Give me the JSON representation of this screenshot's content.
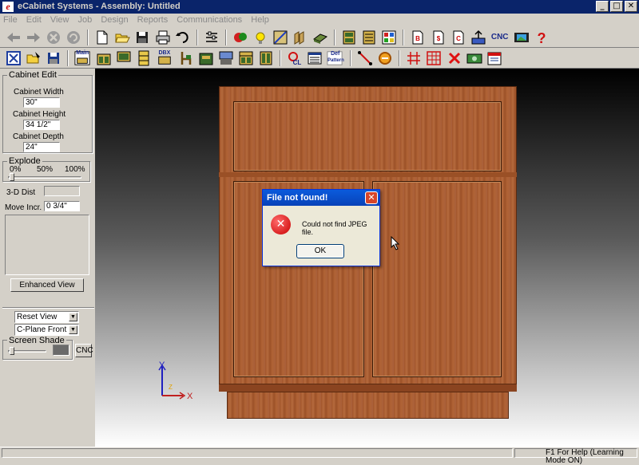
{
  "window": {
    "title": "eCabinet Systems - Assembly: Untitled",
    "icon_glyph": "e",
    "minimize_glyph": "_",
    "maximize_glyph": "□",
    "close_glyph": "✕"
  },
  "menu": [
    "File",
    "Edit",
    "View",
    "Job",
    "Design",
    "Reports",
    "Communications",
    "Help"
  ],
  "toolbar1_icons": [
    "back-icon",
    "forward-icon",
    "stop-icon",
    "refresh-icon",
    "new-icon",
    "open-icon",
    "save-icon",
    "print-icon",
    "undo-icon",
    "properties-icon",
    "parts-icon",
    "light-icon",
    "render-icon",
    "panels-icon",
    "material-icon",
    "cabinet-list-icon",
    "cabinet-grid-icon",
    "cabinet-color-icon",
    "bid-report-icon",
    "cost-report-icon",
    "cutlist-report-icon",
    "export-icon",
    "cnc-icon",
    "video-icon",
    "help-icon"
  ],
  "toolbar1_cnc_label": "CNC",
  "toolbar2_icons": [
    "cabinet-edit-icon",
    "open-assembly-icon",
    "save-assembly-icon",
    "main-icon",
    "base-cabinet-icon",
    "wall-cabinet-icon",
    "tall-cabinet-icon",
    "dbx-icon",
    "chair-icon",
    "drawer-icon",
    "corner-icon",
    "hutch-icon",
    "pantry-icon",
    "cutlist-icon",
    "def-icon",
    "pattern-icon",
    "line-draw-icon",
    "curve-icon",
    "grid-icon",
    "table-icon",
    "delete-icon",
    "money-icon",
    "schedule-icon"
  ],
  "toolbar2_labels": {
    "main": "Main",
    "dbx": "DBX",
    "def": "Def",
    "pattern": "Pattern"
  },
  "cabinet_edit": {
    "group_label": "Cabinet Edit",
    "width_label": "Cabinet Width",
    "width_value": "30\"",
    "height_label": "Cabinet Height",
    "height_value": "34 1/2\"",
    "depth_label": "Cabinet Depth",
    "depth_value": "24\""
  },
  "explode": {
    "label": "Explode",
    "tick0": "0%",
    "tick50": "50%",
    "tick100": "100%",
    "value_percent": 0
  },
  "dist3d": {
    "label": "3-D Dist",
    "value": ""
  },
  "move_incr": {
    "label": "Move Incr.",
    "value": "0 3/4\""
  },
  "enhanced_view_label": "Enhanced View",
  "view_select": "Reset View",
  "plane_select": "C-Plane Front",
  "screen_shade": {
    "label": "Screen Shade",
    "value_percent": 0
  },
  "cnc_button": "CNC",
  "axes": {
    "y_label": "Y",
    "x_label": "X",
    "z_label": "Z"
  },
  "dialog": {
    "title": "File not found!",
    "message": "Could not find JPEG file.",
    "ok_label": "OK",
    "close_glyph": "✕",
    "error_glyph": "✕"
  },
  "status": {
    "help_text": "F1 For Help (Learning Mode ON)"
  },
  "colors": {
    "title_bar": "#0a246a",
    "wood": "#a85c33",
    "dialog_title": "#0842b8",
    "error_red": "#d61f1f"
  }
}
